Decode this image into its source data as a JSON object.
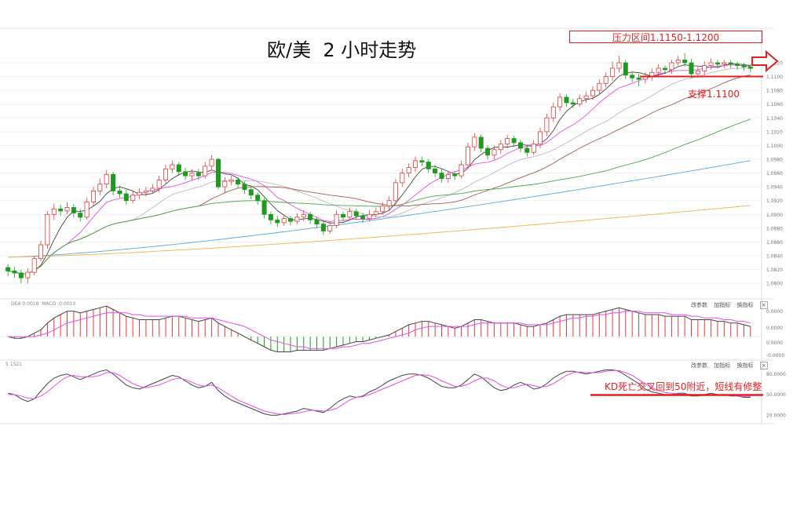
{
  "title": "欧/美  2 小时走势",
  "annotations": {
    "resistance": "压力区间1.1150-1.1200",
    "support": "支撑1.1100",
    "kd_note": "KD死亡交叉回到50附近，短线有修整"
  },
  "colors": {
    "bull": "#e23b3b",
    "bear": "#1e9a1e",
    "annotation": "#e02020",
    "ma5": "#444444",
    "ma10": "#e64ee6",
    "ma20": "#bbbbbb",
    "ma30": "#a85a52",
    "ma60": "#4aa84a",
    "ma120": "#5aa8e0",
    "ma240": "#f2b24a"
  },
  "macd_header": "DEA 0.0018  MACD -0.0010",
  "kd_header": "5 1521",
  "panel_buttons": [
    "改参数",
    "加指标",
    "换指标"
  ],
  "close_glyph": "×",
  "chart_data": [
    {
      "type": "candlestick",
      "title": "欧/美  2 小时走势",
      "price_axis_ticks": [
        "1.1120",
        "1.1100",
        "1.1080",
        "1.1060",
        "1.1040",
        "1.1020",
        "1.1000",
        "1.0980",
        "1.0960",
        "1.0940",
        "1.0920",
        "1.0900",
        "1.0880",
        "1.0860",
        "1.0840",
        "1.0820",
        "1.0800"
      ],
      "ylim": [
        1.079,
        1.1145
      ],
      "grid": true,
      "candles": [
        [
          1.0823,
          1.0818,
          1.0828,
          1.081
        ],
        [
          1.0818,
          1.0815,
          1.0824,
          1.0808
        ],
        [
          1.0815,
          1.0808,
          1.082,
          1.08
        ],
        [
          1.0808,
          1.0816,
          1.0822,
          1.08
        ],
        [
          1.0816,
          1.0836,
          1.084,
          1.0812
        ],
        [
          1.0836,
          1.0856,
          1.0862,
          1.0832
        ],
        [
          1.0856,
          1.09,
          1.0905,
          1.085
        ],
        [
          1.09,
          1.0908,
          1.0916,
          1.0892
        ],
        [
          1.0908,
          1.0905,
          1.0914,
          1.0898
        ],
        [
          1.0905,
          1.091,
          1.0918,
          1.09
        ],
        [
          1.091,
          1.0902,
          1.0915,
          1.0896
        ],
        [
          1.0902,
          1.0896,
          1.0908,
          1.089
        ],
        [
          1.0896,
          1.0918,
          1.0924,
          1.0892
        ],
        [
          1.0918,
          1.0934,
          1.094,
          1.0912
        ],
        [
          1.0934,
          1.0944,
          1.0952,
          1.0928
        ],
        [
          1.0944,
          1.0958,
          1.0964,
          1.0938
        ],
        [
          1.0958,
          1.0934,
          1.0962,
          1.0928
        ],
        [
          1.0934,
          1.093,
          1.0942,
          1.0924
        ],
        [
          1.093,
          1.092,
          1.0936,
          1.0914
        ],
        [
          1.092,
          1.0928,
          1.0934,
          1.0916
        ],
        [
          1.0928,
          1.0932,
          1.0938,
          1.0922
        ],
        [
          1.0932,
          1.0934,
          1.094,
          1.0926
        ],
        [
          1.0934,
          1.0938,
          1.0944,
          1.093
        ],
        [
          1.0938,
          1.095,
          1.0956,
          1.0932
        ],
        [
          1.095,
          1.0966,
          1.0972,
          1.0944
        ],
        [
          1.0966,
          1.0972,
          1.0978,
          1.096
        ],
        [
          1.0972,
          1.0962,
          1.0976,
          1.0956
        ],
        [
          1.0962,
          1.0956,
          1.0968,
          1.095
        ],
        [
          1.0956,
          1.096,
          1.0966,
          1.095
        ],
        [
          1.096,
          1.0956,
          1.0966,
          1.095
        ],
        [
          1.0956,
          1.097,
          1.0976,
          1.0952
        ],
        [
          1.097,
          1.098,
          1.0986,
          1.0964
        ],
        [
          1.098,
          1.094,
          1.0982,
          1.0936
        ],
        [
          1.094,
          1.0948,
          1.0954,
          1.0932
        ],
        [
          1.0948,
          1.095,
          1.0956,
          1.0942
        ],
        [
          1.095,
          1.0944,
          1.0954,
          1.0938
        ],
        [
          1.0944,
          1.0936,
          1.0948,
          1.093
        ],
        [
          1.0936,
          1.0928,
          1.094,
          1.0922
        ],
        [
          1.0928,
          1.092,
          1.0932,
          1.0914
        ],
        [
          1.092,
          1.09,
          1.0924,
          1.0894
        ],
        [
          1.09,
          1.0892,
          1.0904,
          1.0886
        ],
        [
          1.0892,
          1.0888,
          1.0898,
          1.0882
        ],
        [
          1.0888,
          1.0894,
          1.09,
          1.0884
        ],
        [
          1.0894,
          1.089,
          1.0898,
          1.0884
        ],
        [
          1.089,
          1.0896,
          1.0902,
          1.0886
        ],
        [
          1.0896,
          1.09,
          1.0906,
          1.089
        ],
        [
          1.09,
          1.0892,
          1.0904,
          1.0886
        ],
        [
          1.0892,
          1.0886,
          1.0896,
          1.088
        ],
        [
          1.0886,
          1.0876,
          1.089,
          1.087
        ],
        [
          1.0876,
          1.0884,
          1.089,
          1.0872
        ],
        [
          1.0884,
          1.09,
          1.0906,
          1.088
        ],
        [
          1.09,
          1.0896,
          1.0904,
          1.089
        ],
        [
          1.0896,
          1.0904,
          1.091,
          1.0892
        ],
        [
          1.0904,
          1.0898,
          1.0908,
          1.0892
        ],
        [
          1.0898,
          1.0894,
          1.0902,
          1.0888
        ],
        [
          1.0894,
          1.09,
          1.0906,
          1.089
        ],
        [
          1.09,
          1.0904,
          1.091,
          1.0896
        ],
        [
          1.0904,
          1.0912,
          1.0918,
          1.09
        ],
        [
          1.0912,
          1.092,
          1.0926,
          1.0906
        ],
        [
          1.092,
          1.0946,
          1.0952,
          1.0914
        ],
        [
          1.0946,
          1.096,
          1.0966,
          1.094
        ],
        [
          1.096,
          1.0968,
          1.0974,
          1.0954
        ],
        [
          1.0968,
          1.0978,
          1.0984,
          1.0962
        ],
        [
          1.0978,
          1.0976,
          1.0984,
          1.097
        ],
        [
          1.0976,
          1.0966,
          1.098,
          1.096
        ],
        [
          1.0966,
          1.096,
          1.0972,
          1.0954
        ],
        [
          1.096,
          1.0952,
          1.0966,
          1.0946
        ],
        [
          1.0952,
          1.0958,
          1.0962,
          1.0946
        ],
        [
          1.0958,
          1.0956,
          1.0962,
          1.095
        ],
        [
          1.0956,
          1.0972,
          1.0978,
          1.0952
        ],
        [
          1.0972,
          1.0998,
          1.1004,
          1.0966
        ],
        [
          1.0998,
          1.1012,
          1.1018,
          1.0992
        ],
        [
          1.1012,
          1.0996,
          1.1016,
          1.099
        ],
        [
          1.0996,
          1.0986,
          1.1,
          1.098
        ],
        [
          1.0986,
          1.0994,
          1.1,
          1.098
        ],
        [
          1.0994,
          1.1002,
          1.1008,
          1.0988
        ],
        [
          1.1002,
          1.101,
          1.1016,
          1.0996
        ],
        [
          1.101,
          1.1004,
          1.1014,
          1.0998
        ],
        [
          1.1004,
          1.0996,
          1.1008,
          1.099
        ],
        [
          1.0996,
          1.099,
          1.1,
          1.0984
        ],
        [
          1.099,
          1.1002,
          1.1008,
          1.0986
        ],
        [
          1.1002,
          1.102,
          1.1026,
          1.0996
        ],
        [
          1.102,
          1.104,
          1.1046,
          1.1014
        ],
        [
          1.104,
          1.1056,
          1.1062,
          1.1034
        ],
        [
          1.1056,
          1.107,
          1.1076,
          1.105
        ],
        [
          1.107,
          1.1062,
          1.1074,
          1.1056
        ],
        [
          1.1062,
          1.106,
          1.1068,
          1.1054
        ],
        [
          1.106,
          1.1068,
          1.1074,
          1.1056
        ],
        [
          1.1068,
          1.1072,
          1.1078,
          1.1062
        ],
        [
          1.1072,
          1.108,
          1.1086,
          1.1066
        ],
        [
          1.108,
          1.109,
          1.1096,
          1.1074
        ],
        [
          1.109,
          1.11,
          1.1106,
          1.1084
        ],
        [
          1.11,
          1.1112,
          1.1122,
          1.1094
        ],
        [
          1.1112,
          1.112,
          1.113,
          1.1106
        ],
        [
          1.112,
          1.1102,
          1.1124,
          1.1096
        ],
        [
          1.1102,
          1.1098,
          1.1108,
          1.1092
        ],
        [
          1.1098,
          1.1096,
          1.1104,
          1.1086
        ],
        [
          1.1096,
          1.11,
          1.1106,
          1.109
        ],
        [
          1.11,
          1.1106,
          1.1112,
          1.1094
        ],
        [
          1.1106,
          1.1112,
          1.1118,
          1.11
        ],
        [
          1.1112,
          1.111,
          1.1116,
          1.1104
        ],
        [
          1.111,
          1.112,
          1.1124,
          1.1104
        ],
        [
          1.112,
          1.1124,
          1.113,
          1.1116
        ],
        [
          1.1124,
          1.112,
          1.1134,
          1.1114
        ],
        [
          1.112,
          1.1104,
          1.1126,
          1.1098
        ],
        [
          1.1104,
          1.1108,
          1.1114,
          1.1098
        ],
        [
          1.1108,
          1.1116,
          1.1122,
          1.1102
        ],
        [
          1.1116,
          1.112,
          1.1126,
          1.111
        ],
        [
          1.112,
          1.1118,
          1.1124,
          1.1112
        ],
        [
          1.1118,
          1.112,
          1.1124,
          1.1112
        ],
        [
          1.112,
          1.1118,
          1.1124,
          1.1112
        ],
        [
          1.1118,
          1.1116,
          1.1122,
          1.111
        ],
        [
          1.1116,
          1.1114,
          1.112,
          1.1108
        ],
        [
          1.1114,
          1.1112,
          1.1118,
          1.1106
        ]
      ],
      "moving_averages": [
        {
          "period": 5
        },
        {
          "period": 10
        },
        {
          "period": 20
        },
        {
          "period": 30
        },
        {
          "period": 60
        },
        {
          "period": 120
        },
        {
          "period": 240
        }
      ],
      "resistance_zone": [
        1.115,
        1.12
      ],
      "support": 1.11
    },
    {
      "type": "line",
      "indicator": "MACD",
      "axis_ticks": [
        "0.0000",
        "0.0000",
        "0.0000",
        "-0.0000"
      ],
      "ylim": [
        -0.0012,
        0.0019
      ],
      "diff": [
        0.0,
        -0.0001,
        -0.0001,
        0.0,
        0.0002,
        0.0004,
        0.0008,
        0.0011,
        0.0013,
        0.0015,
        0.0015,
        0.0014,
        0.0015,
        0.0016,
        0.0017,
        0.0018,
        0.0016,
        0.0014,
        0.0012,
        0.0011,
        0.001,
        0.001,
        0.001,
        0.001,
        0.0011,
        0.0012,
        0.0012,
        0.0011,
        0.001,
        0.0009,
        0.001,
        0.0011,
        0.0008,
        0.0006,
        0.0004,
        0.0002,
        0.0,
        -0.0002,
        -0.0004,
        -0.0006,
        -0.0008,
        -0.0009,
        -0.0009,
        -0.0009,
        -0.0008,
        -0.0008,
        -0.0008,
        -0.0008,
        -0.0008,
        -0.0007,
        -0.0006,
        -0.0005,
        -0.0004,
        -0.0003,
        -0.0003,
        -0.0002,
        -0.0001,
        0.0,
        0.0001,
        0.0003,
        0.0005,
        0.0007,
        0.0008,
        0.0009,
        0.0009,
        0.0008,
        0.0007,
        0.0006,
        0.0005,
        0.0006,
        0.0008,
        0.001,
        0.001,
        0.0009,
        0.0008,
        0.0008,
        0.0008,
        0.0008,
        0.0007,
        0.0006,
        0.0006,
        0.0007,
        0.0008,
        0.001,
        0.0012,
        0.0013,
        0.0013,
        0.0013,
        0.0013,
        0.0013,
        0.0014,
        0.0015,
        0.0016,
        0.0017,
        0.0016,
        0.0015,
        0.0014,
        0.0013,
        0.0013,
        0.0013,
        0.0012,
        0.0012,
        0.0012,
        0.0012,
        0.001,
        0.001,
        0.001,
        0.001,
        0.0009,
        0.0009,
        0.0008,
        0.0008,
        0.0007,
        0.0006
      ],
      "dea": [
        0.0,
        0.0,
        0.0,
        0.0,
        0.0,
        0.0001,
        0.0002,
        0.0004,
        0.0006,
        0.0008,
        0.0009,
        0.001,
        0.0011,
        0.0012,
        0.0013,
        0.0014,
        0.0014,
        0.0014,
        0.0014,
        0.0013,
        0.0013,
        0.0012,
        0.0012,
        0.0012,
        0.0012,
        0.0012,
        0.0012,
        0.0012,
        0.0011,
        0.0011,
        0.0011,
        0.0011,
        0.001,
        0.0009,
        0.0008,
        0.0007,
        0.0006,
        0.0004,
        0.0002,
        0.0,
        -0.0002,
        -0.0003,
        -0.0004,
        -0.0005,
        -0.0006,
        -0.0006,
        -0.0007,
        -0.0007,
        -0.0007,
        -0.0007,
        -0.0007,
        -0.0006,
        -0.0006,
        -0.0005,
        -0.0004,
        -0.0004,
        -0.0003,
        -0.0002,
        -0.0001,
        0.0,
        0.0001,
        0.0002,
        0.0004,
        0.0005,
        0.0006,
        0.0006,
        0.0006,
        0.0006,
        0.0006,
        0.0006,
        0.0006,
        0.0007,
        0.0008,
        0.0008,
        0.0008,
        0.0008,
        0.0008,
        0.0008,
        0.0008,
        0.0007,
        0.0007,
        0.0007,
        0.0007,
        0.0008,
        0.0009,
        0.001,
        0.0011,
        0.0011,
        0.0012,
        0.0012,
        0.0013,
        0.0013,
        0.0014,
        0.0014,
        0.0015,
        0.0015,
        0.0015,
        0.0014,
        0.0014,
        0.0014,
        0.0014,
        0.0013,
        0.0013,
        0.0013,
        0.0012,
        0.0012,
        0.0011,
        0.0011,
        0.0011,
        0.001,
        0.001,
        0.0009,
        0.0009,
        0.0008
      ]
    },
    {
      "type": "line",
      "indicator": "KD",
      "axis_ticks": [
        "80.0000",
        "50.0000",
        "20.0000"
      ],
      "ylim": [
        10,
        90
      ],
      "reference_level": 50,
      "k": [
        52,
        50,
        44,
        40,
        44,
        55,
        66,
        74,
        78,
        80,
        76,
        72,
        76,
        80,
        84,
        86,
        80,
        72,
        64,
        60,
        58,
        62,
        66,
        70,
        74,
        78,
        76,
        70,
        64,
        60,
        62,
        68,
        56,
        48,
        42,
        38,
        34,
        30,
        26,
        22,
        20,
        20,
        22,
        24,
        26,
        30,
        28,
        26,
        24,
        30,
        38,
        44,
        48,
        46,
        48,
        54,
        58,
        64,
        70,
        74,
        78,
        80,
        80,
        78,
        74,
        68,
        62,
        60,
        60,
        64,
        72,
        80,
        76,
        68,
        60,
        56,
        58,
        64,
        68,
        64,
        58,
        60,
        66,
        74,
        80,
        84,
        84,
        82,
        80,
        82,
        84,
        86,
        86,
        84,
        78,
        72,
        66,
        58,
        54,
        52,
        50,
        50,
        52,
        52,
        48,
        48,
        50,
        52,
        50,
        50,
        48,
        48,
        46,
        46
      ],
      "d": [
        50,
        50,
        48,
        45,
        44,
        48,
        54,
        62,
        70,
        76,
        78,
        76,
        76,
        76,
        78,
        82,
        82,
        78,
        72,
        66,
        62,
        60,
        62,
        64,
        68,
        72,
        74,
        72,
        68,
        64,
        62,
        64,
        60,
        54,
        48,
        42,
        38,
        34,
        30,
        26,
        24,
        22,
        21,
        22,
        23,
        25,
        27,
        27,
        26,
        27,
        30,
        36,
        42,
        46,
        47,
        50,
        54,
        58,
        62,
        66,
        70,
        74,
        78,
        79,
        78,
        75,
        70,
        66,
        62,
        62,
        65,
        70,
        74,
        74,
        70,
        64,
        60,
        60,
        63,
        65,
        63,
        61,
        62,
        66,
        72,
        78,
        82,
        83,
        82,
        82,
        82,
        84,
        85,
        85,
        82,
        78,
        72,
        66,
        60,
        56,
        53,
        52,
        51,
        51,
        50,
        49,
        49,
        50,
        50,
        50,
        49,
        48,
        47,
        47
      ]
    }
  ]
}
